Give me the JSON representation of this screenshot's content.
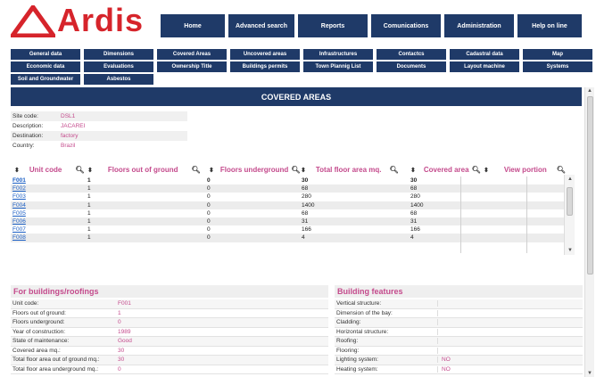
{
  "brand": {
    "logo_text": "Ardis",
    "colors": {
      "nav": "#1f3a68",
      "accent": "#c44a8c",
      "logo_red": "#d6242b",
      "link": "#1a5ec4"
    }
  },
  "main_nav": [
    "Home",
    "Advanced search",
    "Reports",
    "Comunications",
    "Administration",
    "Help on line"
  ],
  "sub_nav": [
    "General data",
    "Dimensions",
    "Covered Areas",
    "Uncovered areas",
    "Infrastructures",
    "Contactcs",
    "Cadastral data",
    "Map",
    "Economic data",
    "Evaluations",
    "Ownership Title",
    "Buildings permits",
    "Town Plannig List",
    "Documents",
    "Layout machine",
    "Systems",
    "Soil and Groundwater",
    "Asbestos"
  ],
  "section_title": "COVERED AREAS",
  "site_info": [
    {
      "label": "Site code:",
      "value": "DSL1"
    },
    {
      "label": "Description:",
      "value": "JACAREI"
    },
    {
      "label": "Destination:",
      "value": "factory"
    },
    {
      "label": "Country:",
      "value": "Brazil"
    }
  ],
  "table": {
    "columns": [
      "Unit code",
      "Floors out of ground",
      "Floors underground",
      "Total floor area mq.",
      "Covered area",
      "View portion"
    ],
    "rows": [
      {
        "code": "F001",
        "floors_out": "1",
        "floors_under": "0",
        "total_area": "30",
        "covered": "30"
      },
      {
        "code": "F002",
        "floors_out": "1",
        "floors_under": "0",
        "total_area": "68",
        "covered": "68"
      },
      {
        "code": "F003",
        "floors_out": "1",
        "floors_under": "0",
        "total_area": "280",
        "covered": "280"
      },
      {
        "code": "F004",
        "floors_out": "1",
        "floors_under": "0",
        "total_area": "1400",
        "covered": "1400"
      },
      {
        "code": "F005",
        "floors_out": "1",
        "floors_under": "0",
        "total_area": "68",
        "covered": "68"
      },
      {
        "code": "F006",
        "floors_out": "1",
        "floors_under": "0",
        "total_area": "31",
        "covered": "31"
      },
      {
        "code": "F007",
        "floors_out": "1",
        "floors_under": "0",
        "total_area": "166",
        "covered": "166"
      },
      {
        "code": "F008",
        "floors_out": "1",
        "floors_under": "0",
        "total_area": "4",
        "covered": "4"
      }
    ]
  },
  "buildings_panel": {
    "title": "For buildings/roofings",
    "rows": [
      {
        "label": "Unit code:",
        "value": "F001"
      },
      {
        "label": "Floors out of ground:",
        "value": "1"
      },
      {
        "label": "Floors underground:",
        "value": "0"
      },
      {
        "label": "Year of construction:",
        "value": "1989"
      },
      {
        "label": "State of maintenance:",
        "value": "Good"
      },
      {
        "label": "Covered area mq.:",
        "value": "30"
      },
      {
        "label": "Total floor area out of ground mq.:",
        "value": "30"
      },
      {
        "label": "Total floor area underground mq.:",
        "value": "0"
      }
    ]
  },
  "features_panel": {
    "title": "Building features",
    "rows": [
      {
        "label": "Vertical structure:",
        "value": ""
      },
      {
        "label": "Dimension of the bay:",
        "value": ""
      },
      {
        "label": "Cladding:",
        "value": ""
      },
      {
        "label": "Horizontal structure:",
        "value": ""
      },
      {
        "label": "Roofing:",
        "value": ""
      },
      {
        "label": "Flooring:",
        "value": ""
      },
      {
        "label": "Lighting system:",
        "value": "NO"
      },
      {
        "label": "Heating system:",
        "value": "NO"
      }
    ]
  }
}
